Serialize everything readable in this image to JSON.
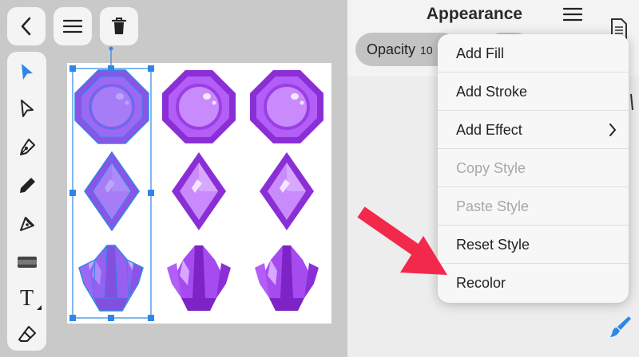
{
  "top_buttons": [
    {
      "name": "back-button",
      "icon": "chevron-left-icon"
    },
    {
      "name": "main-menu-button",
      "icon": "hamburger-icon"
    },
    {
      "name": "delete-button",
      "icon": "trash-icon"
    }
  ],
  "tools": [
    {
      "name": "selection-tool",
      "icon": "arrow-filled-icon",
      "active": true
    },
    {
      "name": "node-tool",
      "icon": "arrow-outline-icon"
    },
    {
      "name": "pen-tool",
      "icon": "pen-nib-icon"
    },
    {
      "name": "pencil-tool",
      "icon": "pencil-icon"
    },
    {
      "name": "vector-brush-tool",
      "icon": "brush-icon"
    },
    {
      "name": "shape-tool",
      "icon": "shape-icon"
    },
    {
      "name": "text-tool",
      "icon": "text-icon",
      "label": "T"
    },
    {
      "name": "eraser-tool",
      "icon": "eraser-icon"
    }
  ],
  "panel": {
    "title": "Appearance",
    "opacity_label": "Opacity",
    "opacity_value": "10"
  },
  "menu": {
    "items": [
      {
        "label": "Add Fill",
        "enabled": true
      },
      {
        "label": "Add Stroke",
        "enabled": true
      },
      {
        "label": "Add Effect",
        "enabled": true,
        "submenu": true
      },
      {
        "label": "Copy Style",
        "enabled": false
      },
      {
        "label": "Paste Style",
        "enabled": false
      },
      {
        "label": "Reset Style",
        "enabled": true
      },
      {
        "label": "Recolor",
        "enabled": true
      }
    ]
  },
  "colors": {
    "accent": "#2e87e6",
    "gem_purple": "#a64bf0",
    "gem_dark": "#7d24c6",
    "annotation_red": "#f2294b"
  }
}
